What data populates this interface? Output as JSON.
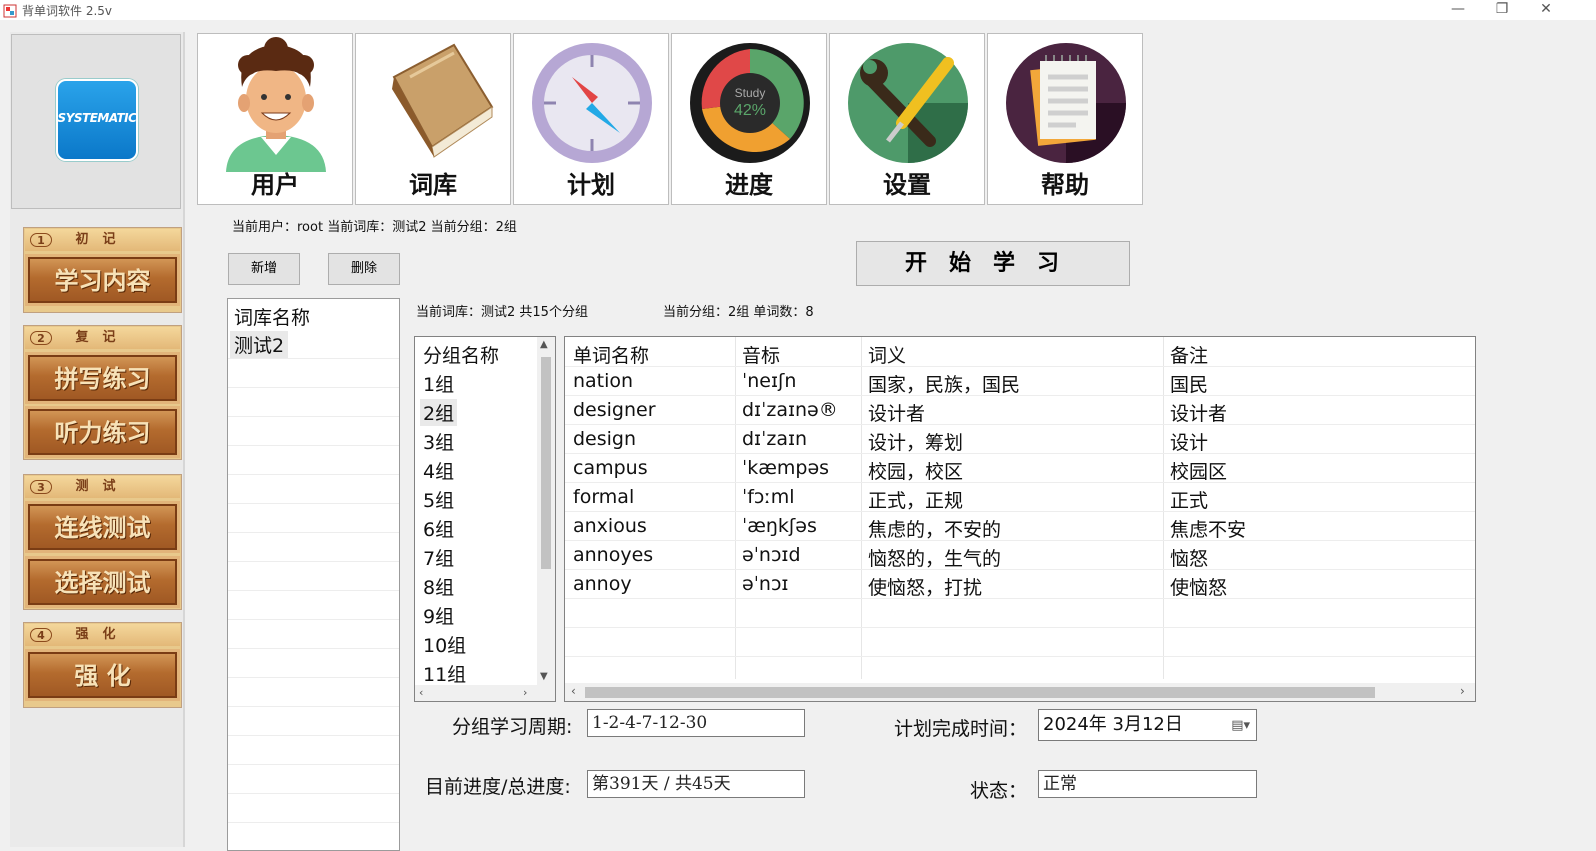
{
  "window": {
    "title": "背单词软件 2.5v",
    "minimize": "—",
    "restore": "❐",
    "close": "✕"
  },
  "logo": {
    "text": "SYSTEMATIC"
  },
  "sidebar": {
    "sections": [
      {
        "num": "1",
        "heading": "初记",
        "buttons": [
          "学习内容"
        ]
      },
      {
        "num": "2",
        "heading": "复记",
        "buttons": [
          "拼写练习",
          "听力练习"
        ]
      },
      {
        "num": "3",
        "heading": "测试",
        "buttons": [
          "连线测试",
          "选择测试"
        ]
      },
      {
        "num": "4",
        "heading": "强化",
        "buttons": [
          "强 化"
        ]
      }
    ]
  },
  "toolbar": {
    "items": [
      {
        "label": "用户",
        "icon": "user-avatar-icon"
      },
      {
        "label": "词库",
        "icon": "book-icon"
      },
      {
        "label": "计划",
        "icon": "compass-icon"
      },
      {
        "label": "进度",
        "icon": "progress-chart-icon",
        "chart_text": "Study",
        "chart_percent": "42%"
      },
      {
        "label": "设置",
        "icon": "wrench-screwdriver-icon"
      },
      {
        "label": "帮助",
        "icon": "notepad-icon"
      }
    ]
  },
  "status": {
    "current": "当前用户：root 当前词库：测试2 当前分组：2组"
  },
  "actions": {
    "add": "新增",
    "delete": "删除",
    "start": "开始学习"
  },
  "library": {
    "header": "词库名称",
    "items": [
      "测试2"
    ]
  },
  "library_info": "当前词库：测试2 共15个分组",
  "group_info": "当前分组：2组 单词数：8",
  "groups": {
    "header": "分组名称",
    "items": [
      "1组",
      "2组",
      "3组",
      "4组",
      "5组",
      "6组",
      "7组",
      "8组",
      "9组",
      "10组",
      "11组"
    ],
    "selected": "2组"
  },
  "words": {
    "columns": [
      "单词名称",
      "音标",
      "词义",
      "备注"
    ],
    "rows": [
      [
        "nation",
        "ˈneɪʃn",
        "国家，民族，国民",
        "国民"
      ],
      [
        "designer",
        "dɪˈzaɪnə®",
        "设计者",
        "设计者"
      ],
      [
        "design",
        "dɪˈzaɪn",
        "设计，筹划",
        "设计"
      ],
      [
        "campus",
        "ˈkæmpəs",
        "校园，校区",
        "校园区"
      ],
      [
        "formal",
        "ˈfɔːml",
        "正式，正规",
        "正式"
      ],
      [
        "anxious",
        "ˈæŋkʃəs",
        "焦虑的，不安的",
        "焦虑不安"
      ],
      [
        "annoyes",
        "əˈnɔɪd",
        "恼怒的，生气的",
        "恼怒"
      ],
      [
        "annoy",
        "əˈnɔɪ",
        "使恼怒，打扰",
        "使恼怒"
      ]
    ]
  },
  "form": {
    "cycle_label": "分组学习周期:",
    "cycle_value": "1-2-4-7-12-30",
    "progress_label": "目前进度/总进度:",
    "progress_value": "第391天 / 共45天",
    "plan_label": "计划完成时间：",
    "plan_date": "2024年 3月12日",
    "status_label": "状态：",
    "status_value": "正常"
  },
  "colors": {
    "logo_blue": "#1a8fdf",
    "wood": "#b46b2e",
    "chart_red": "#e04848",
    "chart_green": "#5aa56a",
    "chart_orange": "#f0a030"
  }
}
